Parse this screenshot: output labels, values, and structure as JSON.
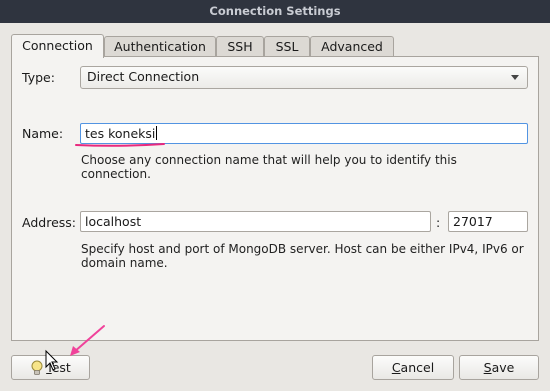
{
  "window": {
    "title": "Connection Settings"
  },
  "tabs": [
    {
      "label": "Connection",
      "active": true
    },
    {
      "label": "Authentication",
      "active": false
    },
    {
      "label": "SSH",
      "active": false
    },
    {
      "label": "SSL",
      "active": false
    },
    {
      "label": "Advanced",
      "active": false
    }
  ],
  "connection": {
    "type_label": "Type:",
    "type_value": "Direct Connection",
    "name_label": "Name:",
    "name_value": "tes koneksi",
    "name_hint": "Choose any connection name that will help you to identify this connection.",
    "address_label": "Address:",
    "host_value": "localhost",
    "port_separator": ":",
    "port_value": "27017",
    "address_hint": "Specify host and port of MongoDB server. Host can be either IPv4, IPv6 or domain name."
  },
  "footer": {
    "test_label": "Test",
    "cancel_label": "Cancel",
    "save_label": "Save"
  },
  "annotation": {
    "underline_color": "#e8287e",
    "arrow_color": "#f0429a"
  }
}
